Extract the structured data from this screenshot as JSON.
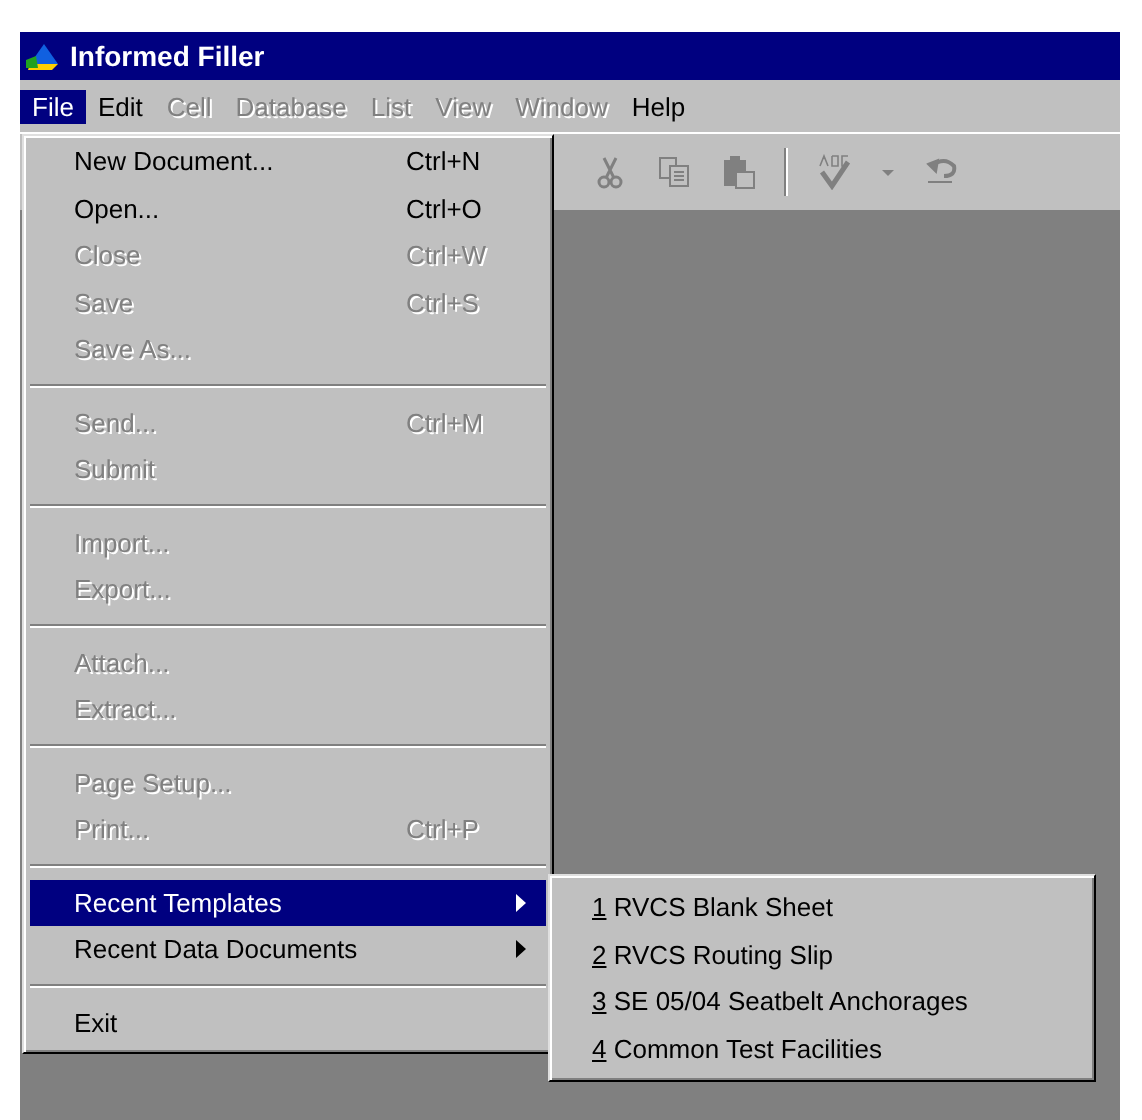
{
  "window": {
    "title": "Informed Filler"
  },
  "menu_bar": [
    {
      "label": "File",
      "selected": true,
      "disabled": false
    },
    {
      "label": "Edit",
      "selected": false,
      "disabled": false
    },
    {
      "label": "Cell",
      "selected": false,
      "disabled": true
    },
    {
      "label": "Database",
      "selected": false,
      "disabled": true
    },
    {
      "label": "List",
      "selected": false,
      "disabled": true
    },
    {
      "label": "View",
      "selected": false,
      "disabled": true
    },
    {
      "label": "Window",
      "selected": false,
      "disabled": true
    },
    {
      "label": "Help",
      "selected": false,
      "disabled": false
    }
  ],
  "file_menu": [
    {
      "kind": "item",
      "label": "New Document...",
      "shortcut": "Ctrl+N",
      "disabled": false,
      "selected": false
    },
    {
      "kind": "item",
      "label": "Open...",
      "shortcut": "Ctrl+O",
      "disabled": false,
      "selected": false
    },
    {
      "kind": "item",
      "label": "Close",
      "shortcut": "Ctrl+W",
      "disabled": true,
      "selected": false
    },
    {
      "kind": "item",
      "label": "Save",
      "shortcut": "Ctrl+S",
      "disabled": true,
      "selected": false
    },
    {
      "kind": "item",
      "label": "Save As...",
      "disabled": true,
      "selected": false
    },
    {
      "kind": "separator"
    },
    {
      "kind": "item",
      "label": "Send...",
      "shortcut": "Ctrl+M",
      "disabled": true,
      "selected": false
    },
    {
      "kind": "item",
      "label": "Submit",
      "disabled": true,
      "selected": false
    },
    {
      "kind": "separator"
    },
    {
      "kind": "item",
      "label": "Import...",
      "disabled": true,
      "selected": false
    },
    {
      "kind": "item",
      "label": "Export...",
      "disabled": true,
      "selected": false
    },
    {
      "kind": "separator"
    },
    {
      "kind": "item",
      "label": "Attach...",
      "disabled": true,
      "selected": false
    },
    {
      "kind": "item",
      "label": "Extract...",
      "disabled": true,
      "selected": false
    },
    {
      "kind": "separator"
    },
    {
      "kind": "item",
      "label": "Page Setup...",
      "disabled": true,
      "selected": false
    },
    {
      "kind": "item",
      "label": "Print...",
      "shortcut": "Ctrl+P",
      "disabled": true,
      "selected": false
    },
    {
      "kind": "separator"
    },
    {
      "kind": "submenu",
      "label": "Recent Templates",
      "disabled": false,
      "selected": true
    },
    {
      "kind": "submenu",
      "label": "Recent Data Documents",
      "disabled": false,
      "selected": false
    },
    {
      "kind": "separator"
    },
    {
      "kind": "item",
      "label": "Exit",
      "disabled": false,
      "selected": false
    }
  ],
  "recent_templates": [
    {
      "number": "1",
      "name": "RVCS Blank Sheet"
    },
    {
      "number": "2",
      "name": "RVCS Routing Slip"
    },
    {
      "number": "3",
      "name": "SE 05/04 Seatbelt Anchorages"
    },
    {
      "number": "4",
      "name": "Common Test Facilities"
    }
  ]
}
